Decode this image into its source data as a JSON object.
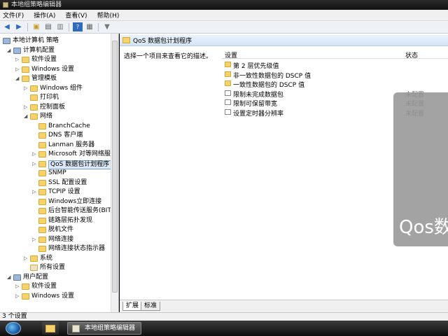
{
  "window": {
    "title": "本地组策略编辑器"
  },
  "menu": [
    "文件(F)",
    "操作(A)",
    "查看(V)",
    "帮助(H)"
  ],
  "toolbar": {
    "icons": [
      "back-arrow-icon",
      "forward-arrow-icon",
      "up-folder-icon",
      "show-hide-tree-icon",
      "export-icon",
      "help-icon",
      "properties-icon",
      "filter-icon"
    ]
  },
  "tree": {
    "root": "本地计算机 策略",
    "items": [
      {
        "label": "计算机配置",
        "level": 1,
        "exp": "◢",
        "icon": "computer"
      },
      {
        "label": "软件设置",
        "level": 2,
        "exp": "▷",
        "icon": "folder"
      },
      {
        "label": "Windows 设置",
        "level": 2,
        "exp": "▷",
        "icon": "folder"
      },
      {
        "label": "管理模板",
        "level": 2,
        "exp": "◢",
        "icon": "folder"
      },
      {
        "label": "Windows 组件",
        "level": 3,
        "exp": "▷",
        "icon": "folder"
      },
      {
        "label": "打印机",
        "level": 3,
        "exp": "",
        "icon": "folder"
      },
      {
        "label": "控制面板",
        "level": 3,
        "exp": "▷",
        "icon": "folder"
      },
      {
        "label": "网络",
        "level": 3,
        "exp": "◢",
        "icon": "folder"
      },
      {
        "label": "BranchCache",
        "level": 4,
        "exp": "",
        "icon": "folder"
      },
      {
        "label": "DNS 客户端",
        "level": 4,
        "exp": "",
        "icon": "folder"
      },
      {
        "label": "Lanman 服务器",
        "level": 4,
        "exp": "",
        "icon": "folder"
      },
      {
        "label": "Microsoft 对等网络服务",
        "level": 4,
        "exp": "▷",
        "icon": "folder"
      },
      {
        "label": "QoS 数据包计划程序",
        "level": 4,
        "exp": "▷",
        "icon": "folder",
        "selected": true
      },
      {
        "label": "SNMP",
        "level": 4,
        "exp": "",
        "icon": "folder"
      },
      {
        "label": "SSL 配置设置",
        "level": 4,
        "exp": "",
        "icon": "folder"
      },
      {
        "label": "TCPIP 设置",
        "level": 4,
        "exp": "▷",
        "icon": "folder"
      },
      {
        "label": "Windows立即连接",
        "level": 4,
        "exp": "",
        "icon": "folder"
      },
      {
        "label": "后台智能传送服务(BITS)",
        "level": 4,
        "exp": "",
        "icon": "folder"
      },
      {
        "label": "链路层拓扑发现",
        "level": 4,
        "exp": "",
        "icon": "folder"
      },
      {
        "label": "脱机文件",
        "level": 4,
        "exp": "",
        "icon": "folder"
      },
      {
        "label": "网络连接",
        "level": 4,
        "exp": "▷",
        "icon": "folder"
      },
      {
        "label": "网络连接状态指示器",
        "level": 4,
        "exp": "",
        "icon": "folder"
      },
      {
        "label": "系统",
        "level": 3,
        "exp": "▷",
        "icon": "folder"
      },
      {
        "label": "所有设置",
        "level": 3,
        "exp": "",
        "icon": "settings"
      },
      {
        "label": "用户配置",
        "level": 1,
        "exp": "◢",
        "icon": "computer"
      },
      {
        "label": "软件设置",
        "level": 2,
        "exp": "▷",
        "icon": "folder"
      },
      {
        "label": "Windows 设置",
        "level": 2,
        "exp": "▷",
        "icon": "folder"
      }
    ]
  },
  "right": {
    "header": "QoS 数据包计划程序",
    "description": "选择一个项目来查看它的描述。",
    "columns": {
      "setting": "设置",
      "state": "状态"
    },
    "rows": [
      {
        "label": "第 2 层优先级值",
        "state": "",
        "type": "folder"
      },
      {
        "label": "非一致性数据包的 DSCP 值",
        "state": "",
        "type": "folder"
      },
      {
        "label": "一致性数据包的 DSCP 值",
        "state": "",
        "type": "folder"
      },
      {
        "label": "限制未完成数据包",
        "state": "未配置",
        "type": "setting"
      },
      {
        "label": "限制可保留带宽",
        "state": "未配置",
        "type": "setting"
      },
      {
        "label": "设置定时器分辨率",
        "state": "未配置",
        "type": "setting"
      }
    ]
  },
  "overlay_text": "Qos数",
  "tabs": [
    "扩展",
    "标准"
  ],
  "status": "3 个设置",
  "taskbar": {
    "button": "本地组策略编辑器"
  }
}
